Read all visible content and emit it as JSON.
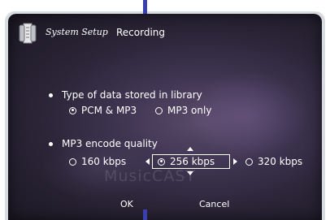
{
  "header": {
    "app_title": "System Setup",
    "page_title": "Recording"
  },
  "library_section": {
    "label": "Type of data stored in library",
    "options": [
      {
        "label": "PCM & MP3",
        "selected": true
      },
      {
        "label": "MP3 only",
        "selected": false
      }
    ]
  },
  "quality_section": {
    "label": "MP3 encode quality",
    "options": [
      {
        "label": "160 kbps",
        "selected": false
      },
      {
        "label": "256 kbps",
        "selected": true
      },
      {
        "label": "320 kbps",
        "selected": false
      }
    ]
  },
  "background": {
    "watermark": "MusicCAST"
  },
  "footer": {
    "ok_label": "OK",
    "cancel_label": "Cancel"
  },
  "colors": {
    "accent": "#3a3fb0",
    "frame": "#d8dce0",
    "dialog_bg": "#2a2436",
    "text": "#ffffff"
  },
  "icons": {
    "app": "settings-scroll-icon",
    "bullet": "bullet-icon",
    "radio": "radio-icon",
    "arrows": "arrow-icon"
  }
}
